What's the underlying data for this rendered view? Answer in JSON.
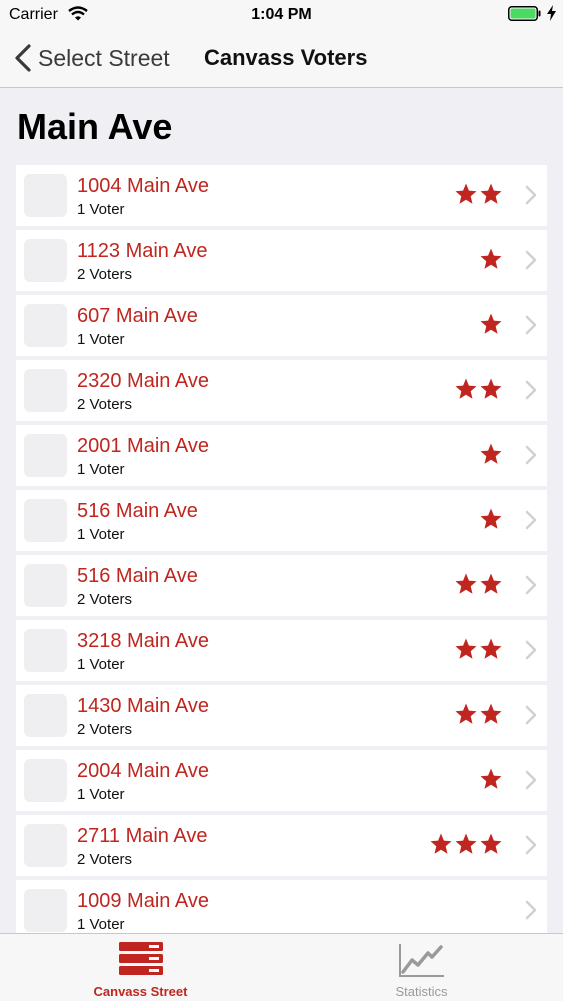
{
  "status": {
    "carrier": "Carrier",
    "time": "1:04 PM"
  },
  "nav": {
    "back_label": "Select Street",
    "title": "Canvass Voters"
  },
  "page": {
    "title": "Main Ave"
  },
  "houses": [
    {
      "address": "1004 Main Ave",
      "voters": "1 Voter",
      "stars": 2
    },
    {
      "address": "1123 Main Ave",
      "voters": "2 Voters",
      "stars": 1
    },
    {
      "address": "607 Main Ave",
      "voters": "1 Voter",
      "stars": 1
    },
    {
      "address": "2320 Main Ave",
      "voters": "2 Voters",
      "stars": 2
    },
    {
      "address": "2001 Main Ave",
      "voters": "1 Voter",
      "stars": 1
    },
    {
      "address": "516 Main Ave",
      "voters": "1 Voter",
      "stars": 1
    },
    {
      "address": "516 Main Ave",
      "voters": "2 Voters",
      "stars": 2
    },
    {
      "address": "3218 Main Ave",
      "voters": "1 Voter",
      "stars": 2
    },
    {
      "address": "1430 Main Ave",
      "voters": "2 Voters",
      "stars": 2
    },
    {
      "address": "2004 Main Ave",
      "voters": "1 Voter",
      "stars": 1
    },
    {
      "address": "2711 Main Ave",
      "voters": "2 Voters",
      "stars": 3
    },
    {
      "address": "1009 Main Ave",
      "voters": "1 Voter",
      "stars": 0
    }
  ],
  "tabs": [
    {
      "label": "Canvass Street",
      "icon": "canvass-street-icon",
      "selected": true
    },
    {
      "label": "Statistics",
      "icon": "statistics-icon",
      "selected": false
    }
  ],
  "colors": {
    "accent": "#c0261f",
    "inactive": "#9a9a9a",
    "battery": "#4cd964"
  }
}
